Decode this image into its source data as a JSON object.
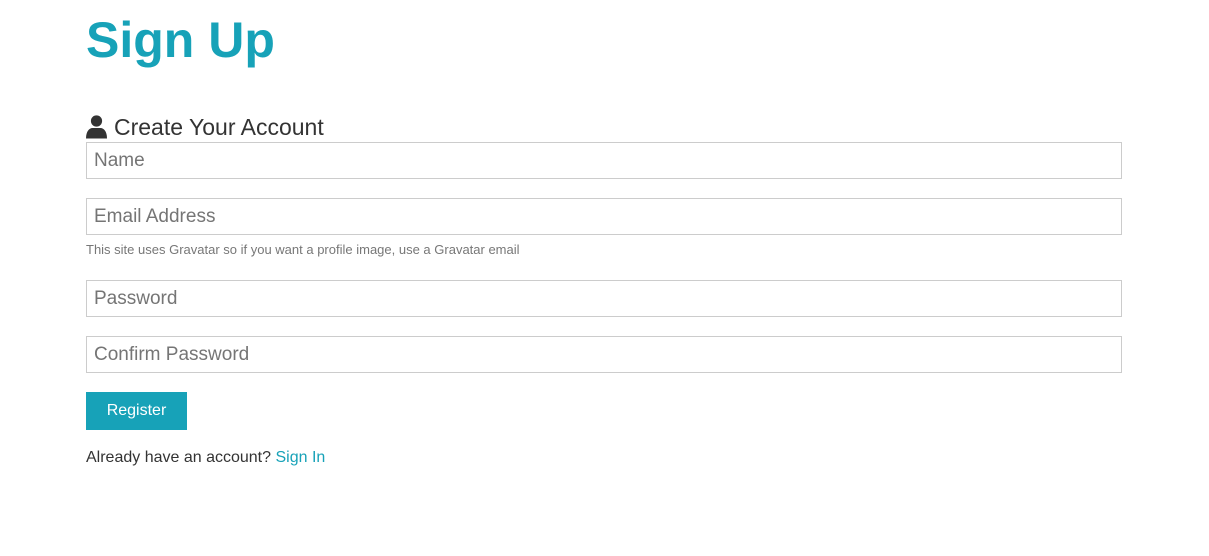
{
  "page": {
    "title": "Sign Up",
    "lead": "Create Your Account",
    "lead_icon": "user-icon"
  },
  "form": {
    "name_placeholder": "Name",
    "email_placeholder": "Email Address",
    "email_help": "This site uses Gravatar so if you want a profile image, use a Gravatar email",
    "password_placeholder": "Password",
    "confirm_password_placeholder": "Confirm Password",
    "submit_label": "Register"
  },
  "footer": {
    "prompt": "Already have an account?",
    "link_label": "Sign In"
  },
  "colors": {
    "accent": "#17a2b8",
    "text": "#333333",
    "muted": "#777777",
    "border": "#cccccc"
  }
}
